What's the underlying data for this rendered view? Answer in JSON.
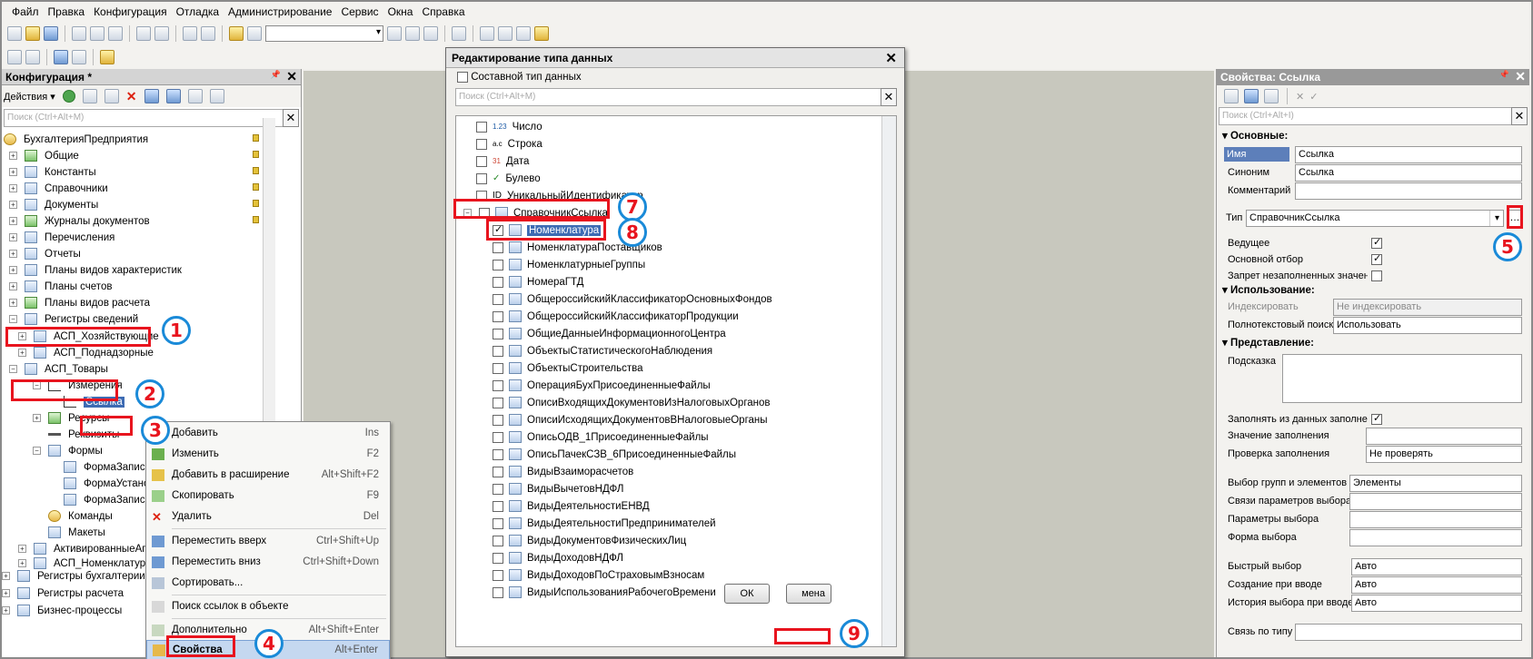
{
  "menu": [
    "Файл",
    "Правка",
    "Конфигурация",
    "Отладка",
    "Администрирование",
    "Сервис",
    "Окна",
    "Справка"
  ],
  "config_panel": {
    "title": "Конфигурация *",
    "actions_label": "Действия ▾",
    "search_placeholder": "Поиск (Ctrl+Alt+M)",
    "tree": [
      "БухгалтерияПредприятия",
      "Общие",
      "Константы",
      "Справочники",
      "Документы",
      "Журналы документов",
      "Перечисления",
      "Отчеты",
      "Планы видов характеристик",
      "Планы счетов",
      "Планы видов расчета",
      "Регистры сведений",
      "АСП_Хозяйствующие",
      "АСП_Поднадзорные",
      "АСП_Товары",
      "Измерения",
      "Ссылка",
      "Ресурсы",
      "Реквизиты",
      "Формы",
      "ФормаЗаписи",
      "ФормаУстановки",
      "ФормаЗаписи",
      "Команды",
      "Макеты",
      "АктивированныеАгенты",
      "АСП_Номенклатура",
      "Регистры бухгалтерии",
      "Регистры расчета",
      "Бизнес-процессы"
    ]
  },
  "context_menu": [
    {
      "label": "Добавить",
      "shortcut": "Ins"
    },
    {
      "label": "Изменить",
      "shortcut": "F2"
    },
    {
      "label": "Добавить в расширение",
      "shortcut": "Alt+Shift+F2"
    },
    {
      "label": "Скопировать",
      "shortcut": "F9"
    },
    {
      "label": "Удалить",
      "shortcut": "Del"
    },
    {
      "label": "Переместить вверх",
      "shortcut": "Ctrl+Shift+Up"
    },
    {
      "label": "Переместить вниз",
      "shortcut": "Ctrl+Shift+Down"
    },
    {
      "label": "Сортировать...",
      "shortcut": ""
    },
    {
      "label": "Поиск ссылок в объекте",
      "shortcut": ""
    },
    {
      "label": "Дополнительно",
      "shortcut": "Alt+Shift+Enter"
    },
    {
      "label": "Свойства",
      "shortcut": "Alt+Enter"
    }
  ],
  "dialog": {
    "title": "Редактирование типа данных",
    "composite_label": "Составной тип данных",
    "search_placeholder": "Поиск (Ctrl+Alt+M)",
    "primitive_types": [
      "Число",
      "Строка",
      "Дата",
      "Булево",
      "УникальныйИдентификатор"
    ],
    "primitive_prefix": [
      "1.23",
      "a.c",
      "31",
      "✓",
      "ID"
    ],
    "group": "СправочникСсылка",
    "selected": "Номенклатура",
    "items": [
      "НоменклатураПоставщиков",
      "НоменклатурныеГруппы",
      "НомераГТД",
      "ОбщероссийскийКлассификаторОсновныхФондов",
      "ОбщероссийскийКлассификаторПродукции",
      "ОбщиеДанныеИнформационногоЦентра",
      "ОбъектыСтатистическогоНаблюдения",
      "ОбъектыСтроительства",
      "ОперацияБухПрисоединенныеФайлы",
      "ОписиВходящихДокументовИзНалоговыхОрганов",
      "ОписиИсходящихДокументовВНалоговыеОрганы",
      "ОписьОДВ_1ПрисоединенныеФайлы",
      "ОписьПачекСЗВ_6ПрисоединенныеФайлы",
      "ВидыВзаиморасчетов",
      "ВидыВычетовНДФЛ",
      "ВидыДеятельностиЕНВД",
      "ВидыДеятельностиПредпринимателей",
      "ВидыДокументовФизическихЛиц",
      "ВидыДоходовНДФЛ",
      "ВидыДоходовПоСтраховымВзносам",
      "ВидыИспользованияРабочегоВремени"
    ],
    "ok_label": "ОК",
    "cancel_label": "Отмена",
    "cancel_visible": "мена"
  },
  "props_panel": {
    "title": "Свойства: Ссылка",
    "search_placeholder": "Поиск (Ctrl+Alt+I)",
    "sections": {
      "basic": "Основные:",
      "usage": "Использование:",
      "presentation": "Представление:"
    },
    "name_label": "Имя",
    "name_value": "Ссылка",
    "synonym_label": "Синоним",
    "synonym_value": "Ссылка",
    "comment_label": "Комментарий",
    "type_label": "Тип",
    "type_value": "СправочникСсылка",
    "leading_label": "Ведущее",
    "main_filter_label": "Основной отбор",
    "deny_empty_label": "Запрет незаполненных значений",
    "index_label": "Индексировать",
    "index_value": "Не индексировать",
    "fulltext_label": "Полнотекстовый поиск",
    "fulltext_value": "Использовать",
    "tooltip_label": "Подсказка",
    "fill_from_label": "Заполнять из данных заполнения",
    "fill_value_label": "Значение заполнения",
    "fill_check_label": "Проверка заполнения",
    "fill_check_value": "Не проверять",
    "choice_groups_label": "Выбор групп и элементов",
    "choice_groups_value": "Элементы",
    "choice_links_label": "Связи параметров выбора",
    "choice_params_label": "Параметры выбора",
    "choice_form_label": "Форма выбора",
    "quick_choice_label": "Быстрый выбор",
    "quick_choice_value": "Авто",
    "create_on_input_label": "Создание при вводе",
    "create_on_input_value": "Авто",
    "history_label": "История выбора при вводе",
    "history_value": "Авто",
    "type_link_label": "Связь по типу"
  },
  "annotations": [
    "1",
    "2",
    "3",
    "4",
    "5",
    "7",
    "8",
    "9"
  ],
  "colors": {
    "annotation_box": "#e8141e",
    "annotation_circle": "#1a8ad8",
    "selection": "#3d6bb3"
  }
}
